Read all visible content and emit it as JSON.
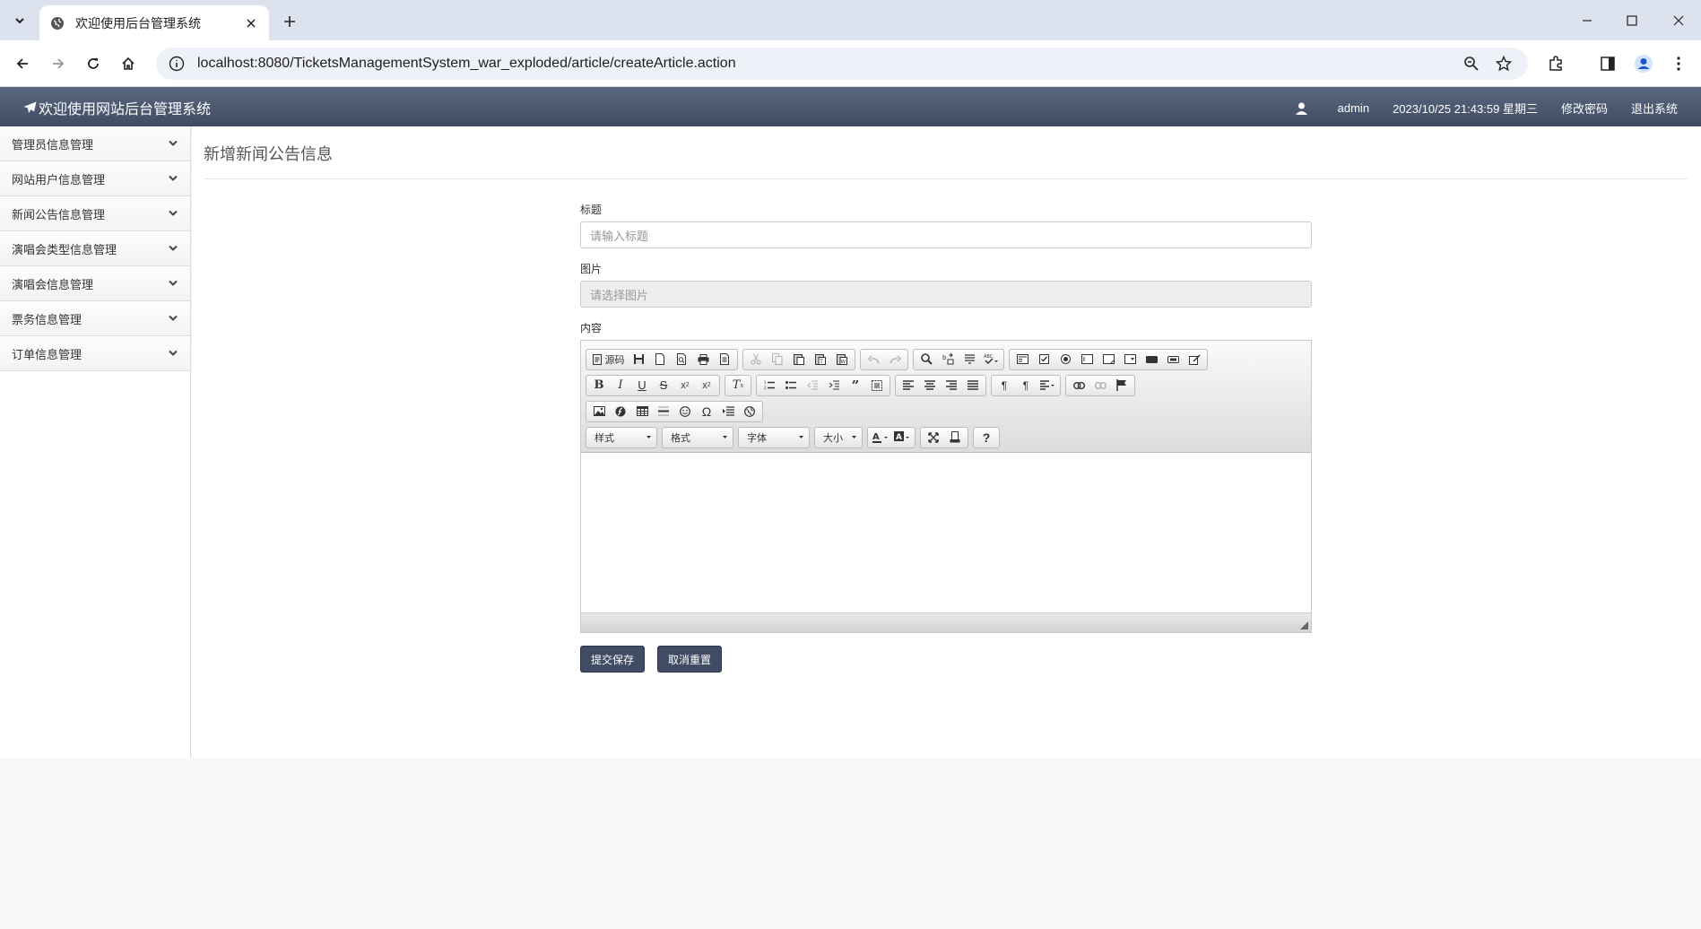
{
  "browser": {
    "tab_title": "欢迎使用后台管理系统",
    "url": "localhost:8080/TicketsManagementSystem_war_exploded/article/createArticle.action"
  },
  "header": {
    "brand": "欢迎使用网站后台管理系统",
    "user": "admin",
    "datetime": "2023/10/25 21:43:59 星期三",
    "change_password": "修改密码",
    "logout": "退出系统"
  },
  "sidebar": {
    "items": [
      {
        "label": "管理员信息管理"
      },
      {
        "label": "网站用户信息管理"
      },
      {
        "label": "新闻公告信息管理"
      },
      {
        "label": "演唱会类型信息管理"
      },
      {
        "label": "演唱会信息管理"
      },
      {
        "label": "票务信息管理"
      },
      {
        "label": "订单信息管理"
      }
    ]
  },
  "page": {
    "title": "新增新闻公告信息",
    "title_field_label": "标题",
    "title_placeholder": "请输入标题",
    "image_field_label": "图片",
    "image_placeholder": "请选择图片",
    "content_field_label": "内容",
    "submit": "提交保存",
    "reset": "取消重置"
  },
  "editor": {
    "source_label": "源码",
    "combos": {
      "style": "样式",
      "format": "格式",
      "font": "字体",
      "size": "大小"
    }
  },
  "colors": {
    "header_top": "#5a6880",
    "header_bottom": "#3f4c63",
    "button": "#3f4c63"
  }
}
